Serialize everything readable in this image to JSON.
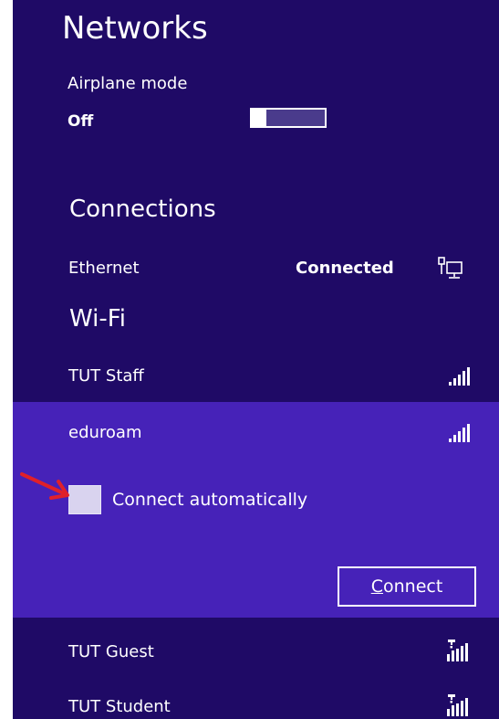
{
  "header": {
    "title": "Networks"
  },
  "airplane_mode": {
    "label": "Airplane mode",
    "state": "Off"
  },
  "connections": {
    "heading": "Connections",
    "ethernet": {
      "label": "Ethernet",
      "status": "Connected",
      "icon": "ethernet-icon"
    }
  },
  "wifi": {
    "heading": "Wi-Fi",
    "networks": [
      {
        "name": "TUT Staff",
        "icon": "wifi-signal-icon"
      },
      {
        "name": "eduroam",
        "icon": "wifi-signal-icon"
      },
      {
        "name": "TUT Guest",
        "icon": "wifi-signal-warning-icon"
      },
      {
        "name": "TUT Student",
        "icon": "wifi-signal-warning-icon"
      }
    ],
    "selected": {
      "connect_automatically_label": "Connect automatically",
      "connect_button_prefix": "C",
      "connect_button_rest": "onnect"
    }
  },
  "colors": {
    "panel_background": "#1f0a66",
    "selected_background": "#4622b8",
    "annotation_arrow": "#e0202a"
  }
}
